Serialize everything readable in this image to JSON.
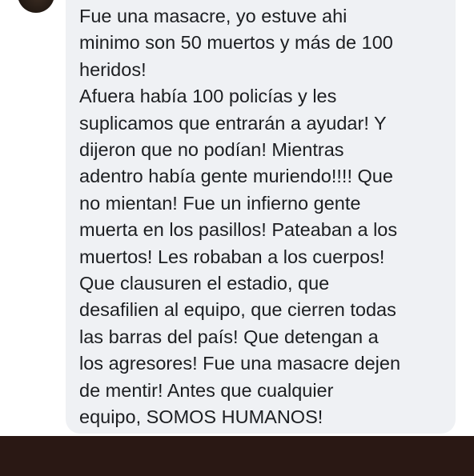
{
  "comment": {
    "author_avatar_icon": "profile-avatar",
    "text": "Fue una masacre, yo estuve ahi\nminimo son 50 muertos y más de 100\nheridos!\nAfuera había 100 policías y les\nsuplicamos que entrarán a ayudar! Y\ndijeron que no podían! Mientras\nadentro había gente muriendo!!!! Que\nno mientan! Fue un infierno gente\nmuerta en los pasillos! Pateaban a los\nmuertos! Les robaban a los cuerpos!\nQue clausuren el estadio, que\ndesafilien al equipo, que cierren todas\nlas barras del país! Que detengan a\nlos agresores! Fue una masacre dejen\nde mentir! Antes que cualquier\nequipo, SOMOS HUMANOS!"
  },
  "colors": {
    "bubble_background": "#eff1f4",
    "text": "#1c1e21",
    "footer_bar": "#2a1814"
  }
}
